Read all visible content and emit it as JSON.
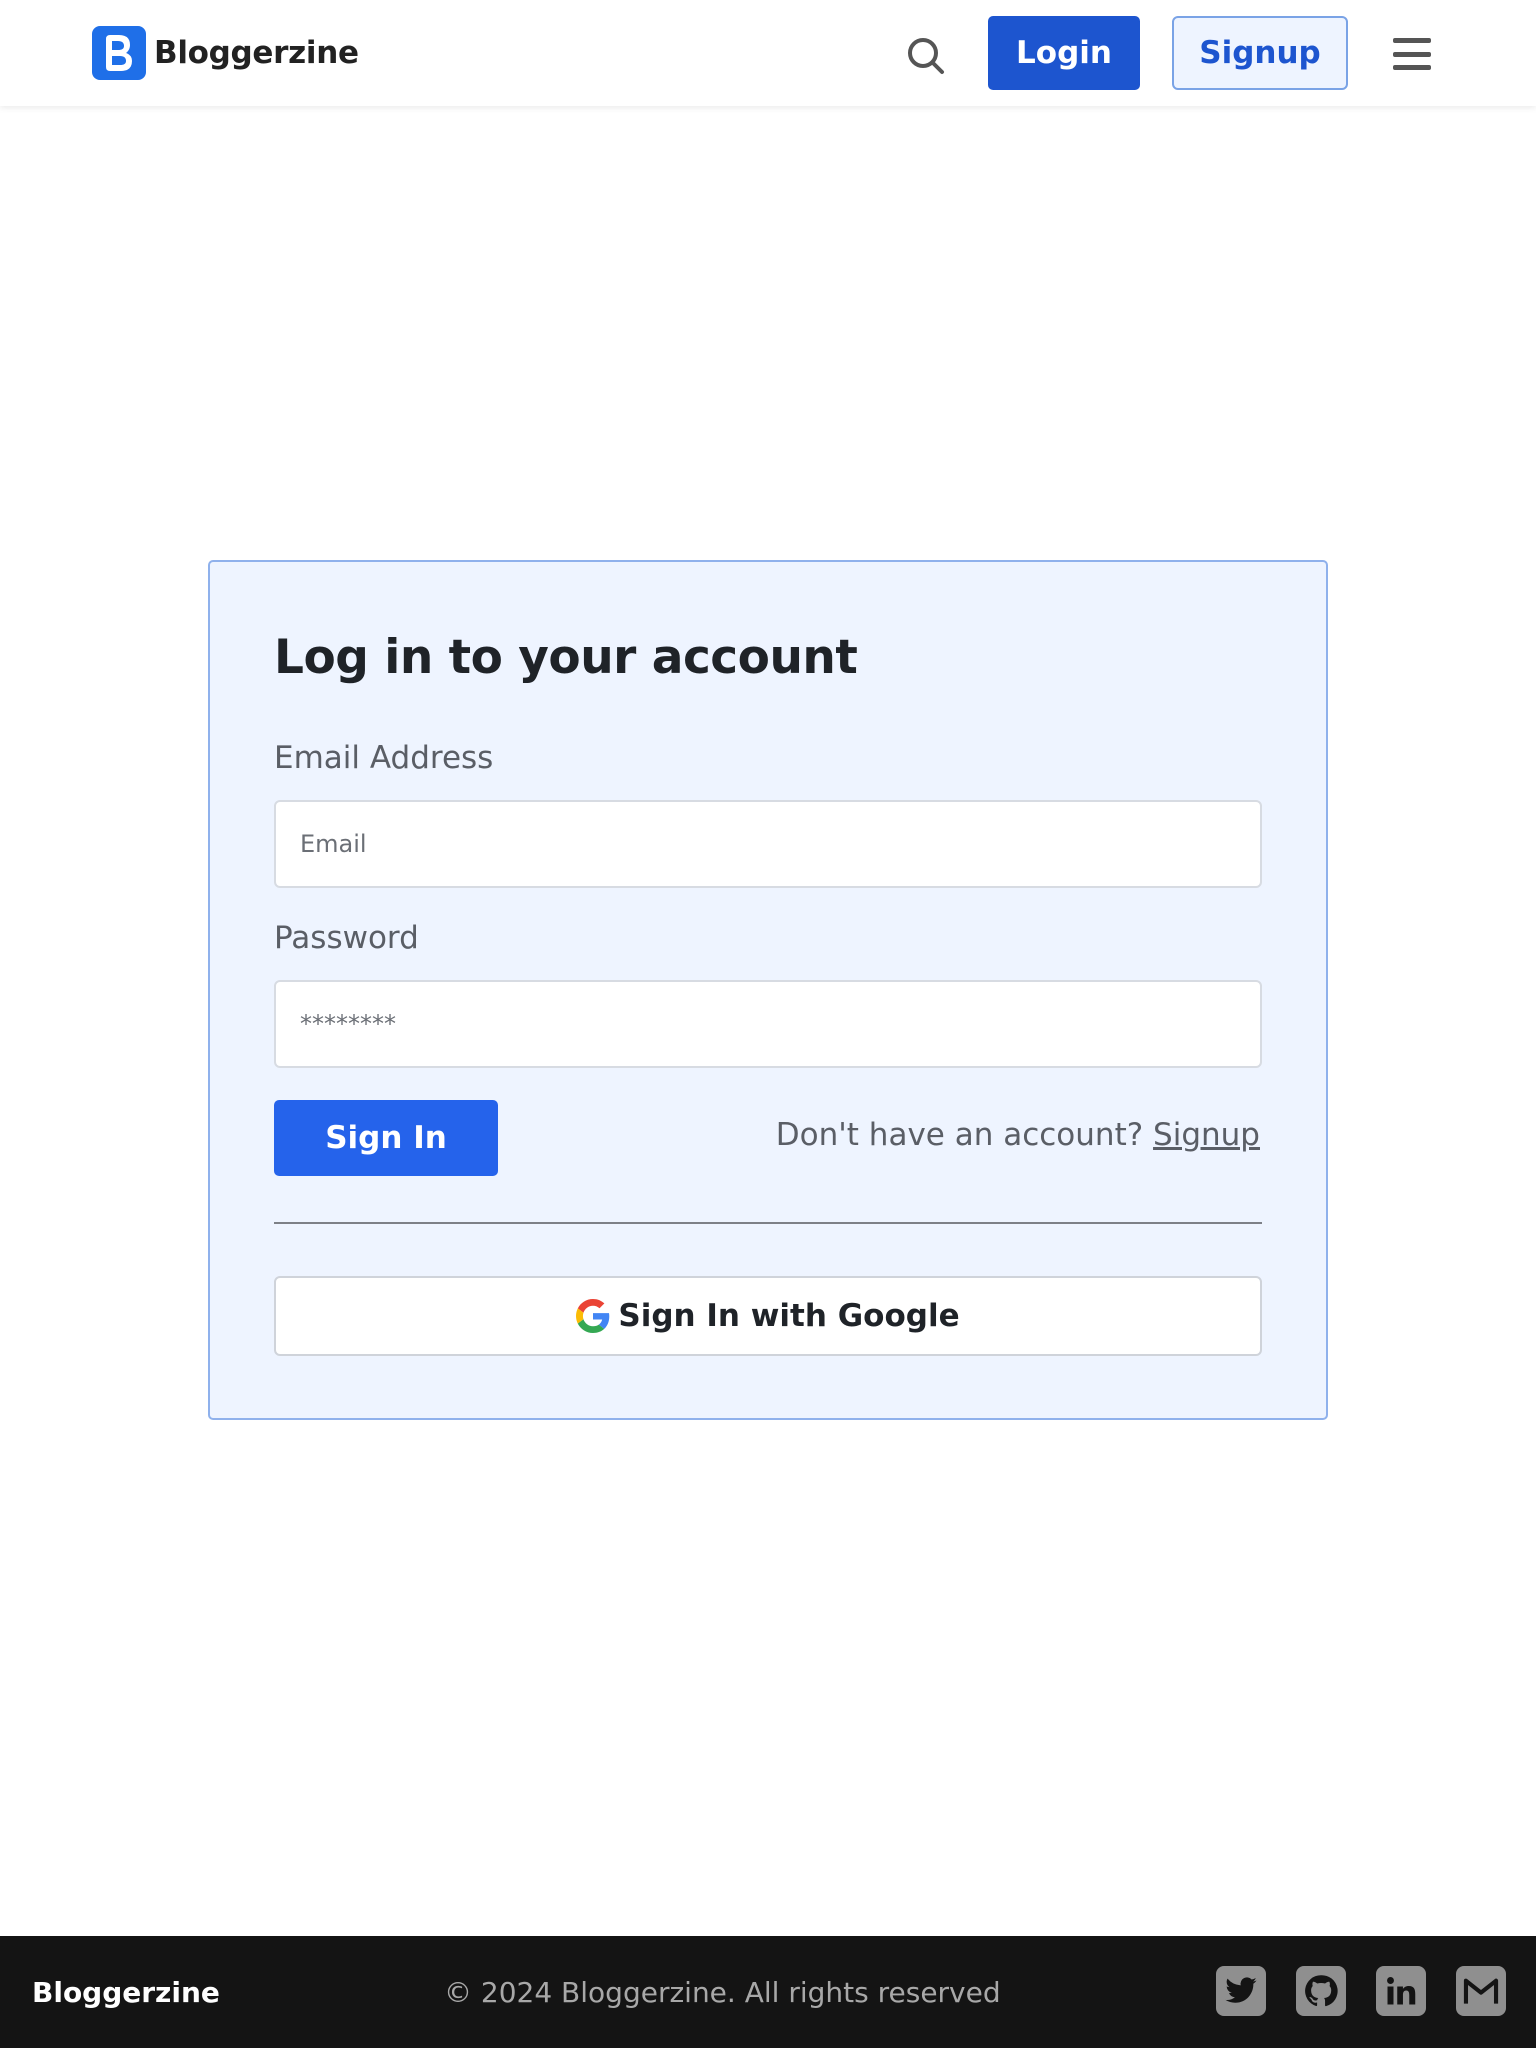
{
  "header": {
    "brand_name": "Bloggerzine",
    "login_label": "Login",
    "signup_label": "Signup"
  },
  "login_card": {
    "title": "Log in to your account",
    "email_label": "Email Address",
    "email_placeholder": "Email",
    "password_label": "Password",
    "password_placeholder": "********",
    "signin_label": "Sign In",
    "no_account_text": "Don't have an account?",
    "signup_link": "Signup",
    "google_label": "Sign In with Google"
  },
  "footer": {
    "brand_name": "Bloggerzine",
    "copyright": "© 2024 Bloggerzine. All rights reserved",
    "social_icons": [
      "twitter-icon",
      "github-icon",
      "linkedin-icon",
      "gmail-icon"
    ]
  },
  "colors": {
    "primary": "#2563eb",
    "login_button": "#1d55cf",
    "card_background": "#eef4ff",
    "card_border": "#8fb1ec",
    "footer_background": "#141414"
  }
}
